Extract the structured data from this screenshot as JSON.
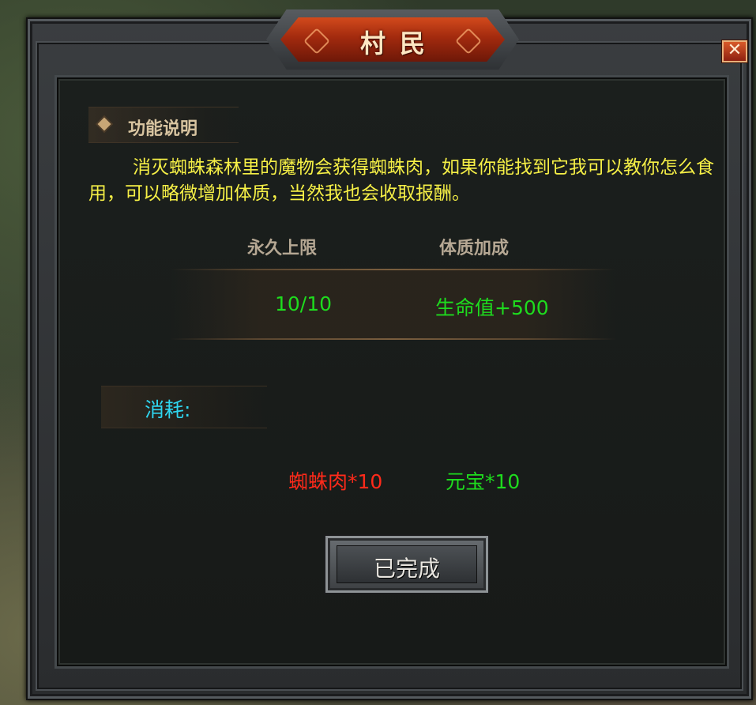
{
  "window": {
    "title": "村民",
    "close_label": "✕"
  },
  "section": {
    "title": "功能说明",
    "description": "消灭蜘蛛森林里的魔物会获得蜘蛛肉，如果你能找到它我可以教你怎么食用，可以略微增加体质，当然我也会收取报酬。"
  },
  "table": {
    "headers": [
      "永久上限",
      "体质加成"
    ],
    "row": [
      "10/10",
      "生命值+500"
    ]
  },
  "cost": {
    "label": "消耗:",
    "items": [
      {
        "text": "蜘蛛肉*10",
        "color": "#ff2a1a"
      },
      {
        "text": "元宝*10",
        "color": "#1edc1e"
      }
    ]
  },
  "button": {
    "label": "已完成"
  },
  "colors": {
    "description": "#f6f046",
    "value_green": "#1edc1e",
    "cost_label": "#2fd6f0",
    "title_plate": "#b83a14"
  }
}
